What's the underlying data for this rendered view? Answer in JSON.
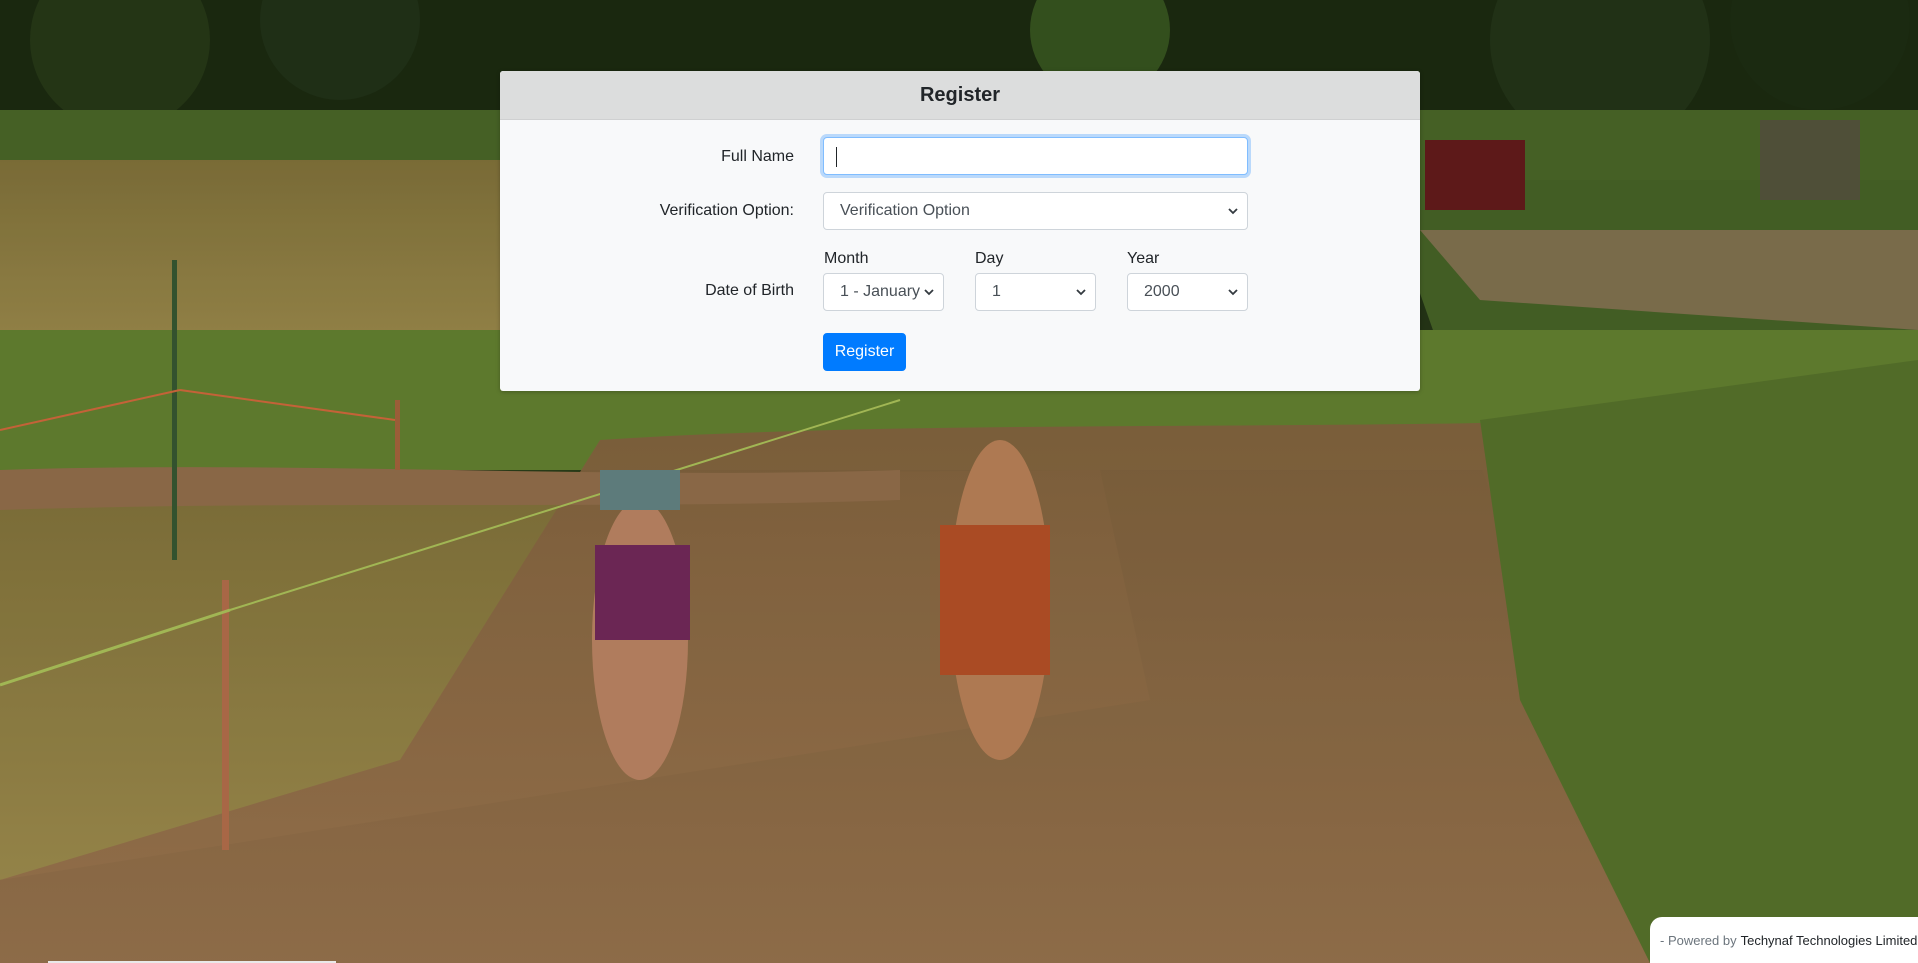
{
  "modal": {
    "title": "Register"
  },
  "form": {
    "full_name_label": "Full Name",
    "full_name_value": "",
    "verification_label": "Verification Option:",
    "verification_selected": "Verification Option",
    "dob_label": "Date of Birth",
    "month_label": "Month",
    "month_selected": "1 - January",
    "day_label": "Day",
    "day_selected": "1",
    "year_label": "Year",
    "year_selected": "2000",
    "submit_label": "Register"
  },
  "footer": {
    "powered_prefix": "- Powered by",
    "company": "Techynaf Technologies Limited"
  },
  "colors": {
    "primary": "#007bff",
    "header_bg": "#dcdddd",
    "card_bg": "#f8f9fa"
  },
  "icons": {
    "select_arrow": "chevron-down-icon"
  }
}
